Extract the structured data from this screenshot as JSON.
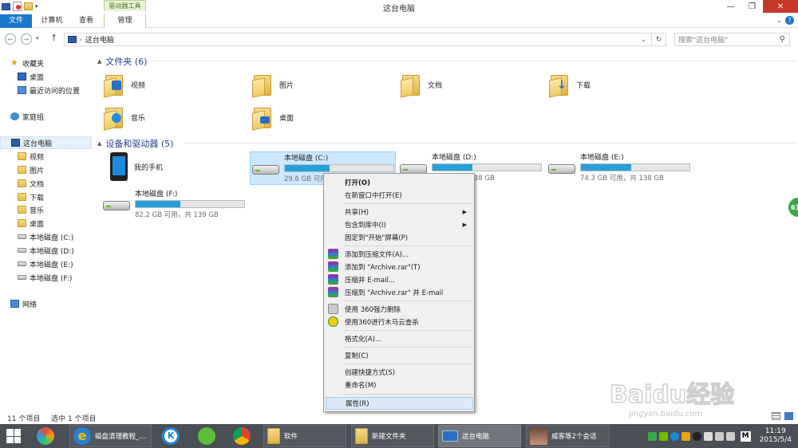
{
  "window": {
    "title": "这台电脑",
    "context_group": "驱动器工具"
  },
  "tabs": [
    {
      "label": "文件"
    },
    {
      "label": "计算机"
    },
    {
      "label": "查看"
    },
    {
      "label": "管理"
    }
  ],
  "address": {
    "path": "这台电脑",
    "search_placeholder": "搜索\"这台电脑\""
  },
  "navpane": {
    "favorites": "收藏夹",
    "fav_items": [
      "桌面",
      "最近访问的位置"
    ],
    "homegroup": "家庭组",
    "thispc": "这台电脑",
    "pc_items": [
      "视频",
      "图片",
      "文档",
      "下载",
      "音乐",
      "桌面",
      "本地磁盘 (C:)",
      "本地磁盘 (D:)",
      "本地磁盘 (E:)",
      "本地磁盘 (F:)"
    ],
    "network": "网络"
  },
  "content": {
    "folders_header": "文件夹 (6)",
    "folders": [
      "视频",
      "图片",
      "文档",
      "下载",
      "音乐",
      "桌面"
    ],
    "devices_header": "设备和驱动器 (5)",
    "phone": "我的手机",
    "drives": [
      {
        "name": "本地磁盘 (C:)",
        "free_text": "29.6 GB 可用，共 ...",
        "used_fraction": 0.41
      },
      {
        "name": "本地磁盘 (D:)",
        "free_text": "... 可用，共 138 GB",
        "used_fraction": 0.37
      },
      {
        "name": "本地磁盘 (E:)",
        "free_text": "74.3 GB 可用，共 138 GB",
        "used_fraction": 0.46
      },
      {
        "name": "本地磁盘 (F:)",
        "free_text": "82.2 GB 可用，共 139 GB",
        "used_fraction": 0.41
      }
    ]
  },
  "context_menu": [
    {
      "label": "打开(O)",
      "bold": true
    },
    {
      "label": "在新窗口中打开(E)"
    },
    {
      "label": "共享(H)",
      "submenu": true
    },
    {
      "label": "包含到库中(I)",
      "submenu": true
    },
    {
      "label": "固定到\"开始\"屏幕(P)"
    },
    {
      "label": "添加到压缩文件(A)...",
      "icon": "winrar-icon"
    },
    {
      "label": "添加到 \"Archive.rar\"(T)",
      "icon": "winrar-icon"
    },
    {
      "label": "压缩并 E-mail...",
      "icon": "winrar-icon"
    },
    {
      "label": "压缩到 \"Archive.rar\" 并 E-mail",
      "icon": "winrar-icon"
    },
    {
      "label": "使用 360强力删除",
      "icon": "shredder-icon"
    },
    {
      "label": "使用360进行木马云查杀",
      "icon": "360-scan-icon"
    },
    {
      "label": "格式化(A)..."
    },
    {
      "label": "复制(C)"
    },
    {
      "label": "创建快捷方式(S)"
    },
    {
      "label": "重命名(M)"
    },
    {
      "label": "属性(R)",
      "highlight": true
    }
  ],
  "status": {
    "items": "11 个项目",
    "selected": "选中 1 个项目"
  },
  "taskbar": {
    "buttons": [
      "磁盘清理教程_...",
      "软件",
      "新建文件夹",
      "这台电脑",
      "威客等2个会话"
    ],
    "time": "11:19",
    "date": "2015/5/4",
    "ime": "M"
  },
  "side_badge": "61",
  "watermark": {
    "brand": "Baidu经验",
    "url": "jingyan.baidu.com"
  },
  "colors": {
    "accent": "#1979ca",
    "drive_fill": "#26a0da",
    "selection": "#cce8ff"
  }
}
